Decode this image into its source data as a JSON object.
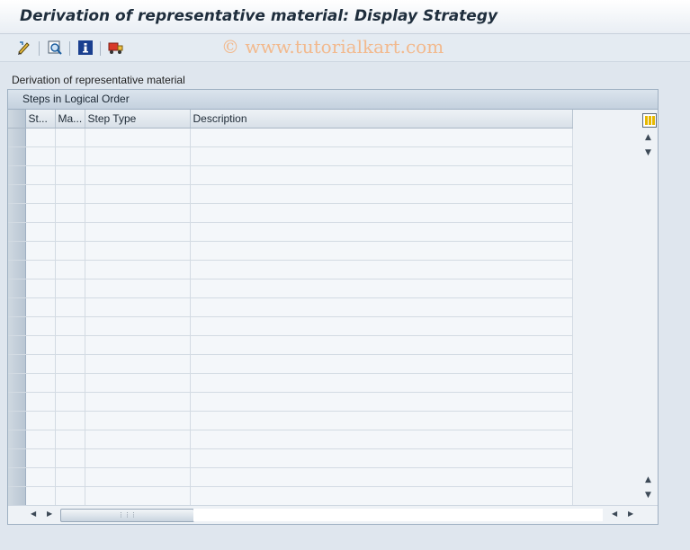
{
  "window": {
    "title": "Derivation of representative material: Display Strategy"
  },
  "toolbar": {
    "buttons": [
      {
        "icon": "pencil-icon",
        "label": "Change"
      },
      {
        "icon": "find-icon",
        "label": "Find"
      },
      {
        "icon": "info-icon",
        "label": "Information"
      },
      {
        "icon": "transport-icon",
        "label": "Transport"
      }
    ]
  },
  "watermark": "© www.tutorialkart.com",
  "section": {
    "label": "Derivation of representative material"
  },
  "table": {
    "title": "Steps in Logical Order",
    "columns": [
      "St...",
      "Ma...",
      "Step Type",
      "Description"
    ],
    "rows": []
  },
  "colors": {
    "background": "#dfe6ee",
    "panel_header": "#c4d1de",
    "watermark": "#f2b98d",
    "title_text": "#1f2e3d"
  }
}
